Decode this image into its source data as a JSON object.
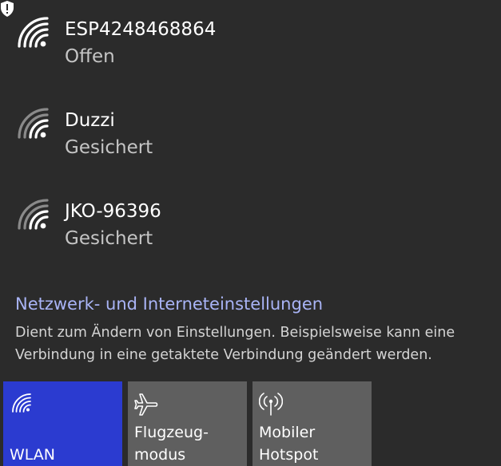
{
  "networks": [
    {
      "name": "ESP4248468864",
      "status": "Offen",
      "icon": "wifi-signal-strong-icon",
      "warning_icon": "shield-warning-icon"
    },
    {
      "name": "Duzzi",
      "status": "Gesichert",
      "icon": "wifi-signal-weak-icon"
    },
    {
      "name": "JKO-96396",
      "status": "Gesichert",
      "icon": "wifi-signal-weak-icon"
    }
  ],
  "settings": {
    "link_label": "Netzwerk- und Interneteinstellungen",
    "description": "Dient zum Ändern von Einstellungen. Beispielsweise kann eine Verbindung in eine getaktete Verbindung geändert werden."
  },
  "tiles": [
    {
      "label_line1": "",
      "label_line2": "WLAN",
      "icon": "wifi-icon",
      "active": true
    },
    {
      "label_line1": "Flugzeug-",
      "label_line2": "modus",
      "icon": "airplane-icon",
      "active": false
    },
    {
      "label_line1": "Mobiler",
      "label_line2": "Hotspot",
      "icon": "hotspot-icon",
      "active": false
    }
  ],
  "colors": {
    "background": "#2b2b2b",
    "link": "#a9b4f6",
    "tile_active": "#2b3bd0",
    "tile_inactive": "#5f5f5f"
  }
}
